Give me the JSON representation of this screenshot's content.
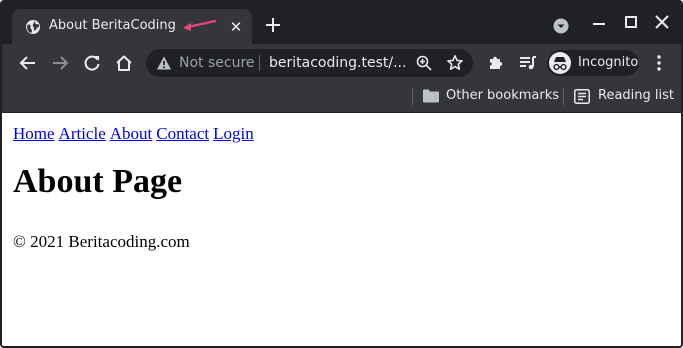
{
  "browser": {
    "tab": {
      "title": "About BeritaCoding",
      "favicon": "globe-icon",
      "close_icon": "close-icon"
    },
    "new_tab_icon": "plus-icon",
    "tab_search_icon": "chevron-down-circle-icon",
    "window_controls": [
      "minimize-icon",
      "maximize-icon",
      "close-icon"
    ],
    "annotation_color": "#e8457a"
  },
  "toolbar": {
    "back_icon": "arrow-left-icon",
    "forward_icon": "arrow-right-icon",
    "reload_icon": "reload-icon",
    "home_icon": "home-icon",
    "security_label": "Not secure",
    "url": "beritacoding.test/...",
    "zoom_icon": "zoom-icon",
    "bookmark_icon": "star-icon",
    "extensions_icon": "puzzle-icon",
    "media_icon": "media-queue-icon",
    "profile_label": "Incognito",
    "menu_icon": "more-vert-icon"
  },
  "bookmarks_bar": {
    "other_bookmarks": "Other bookmarks",
    "reading_list": "Reading list"
  },
  "page": {
    "nav": [
      "Home",
      "Article",
      "About",
      "Contact",
      "Login"
    ],
    "heading": "About Page",
    "footer": "© 2021 Beritacoding.com"
  },
  "colors": {
    "titlebar": "#202124",
    "toolbar": "#35363a",
    "link": "#0000ee"
  }
}
